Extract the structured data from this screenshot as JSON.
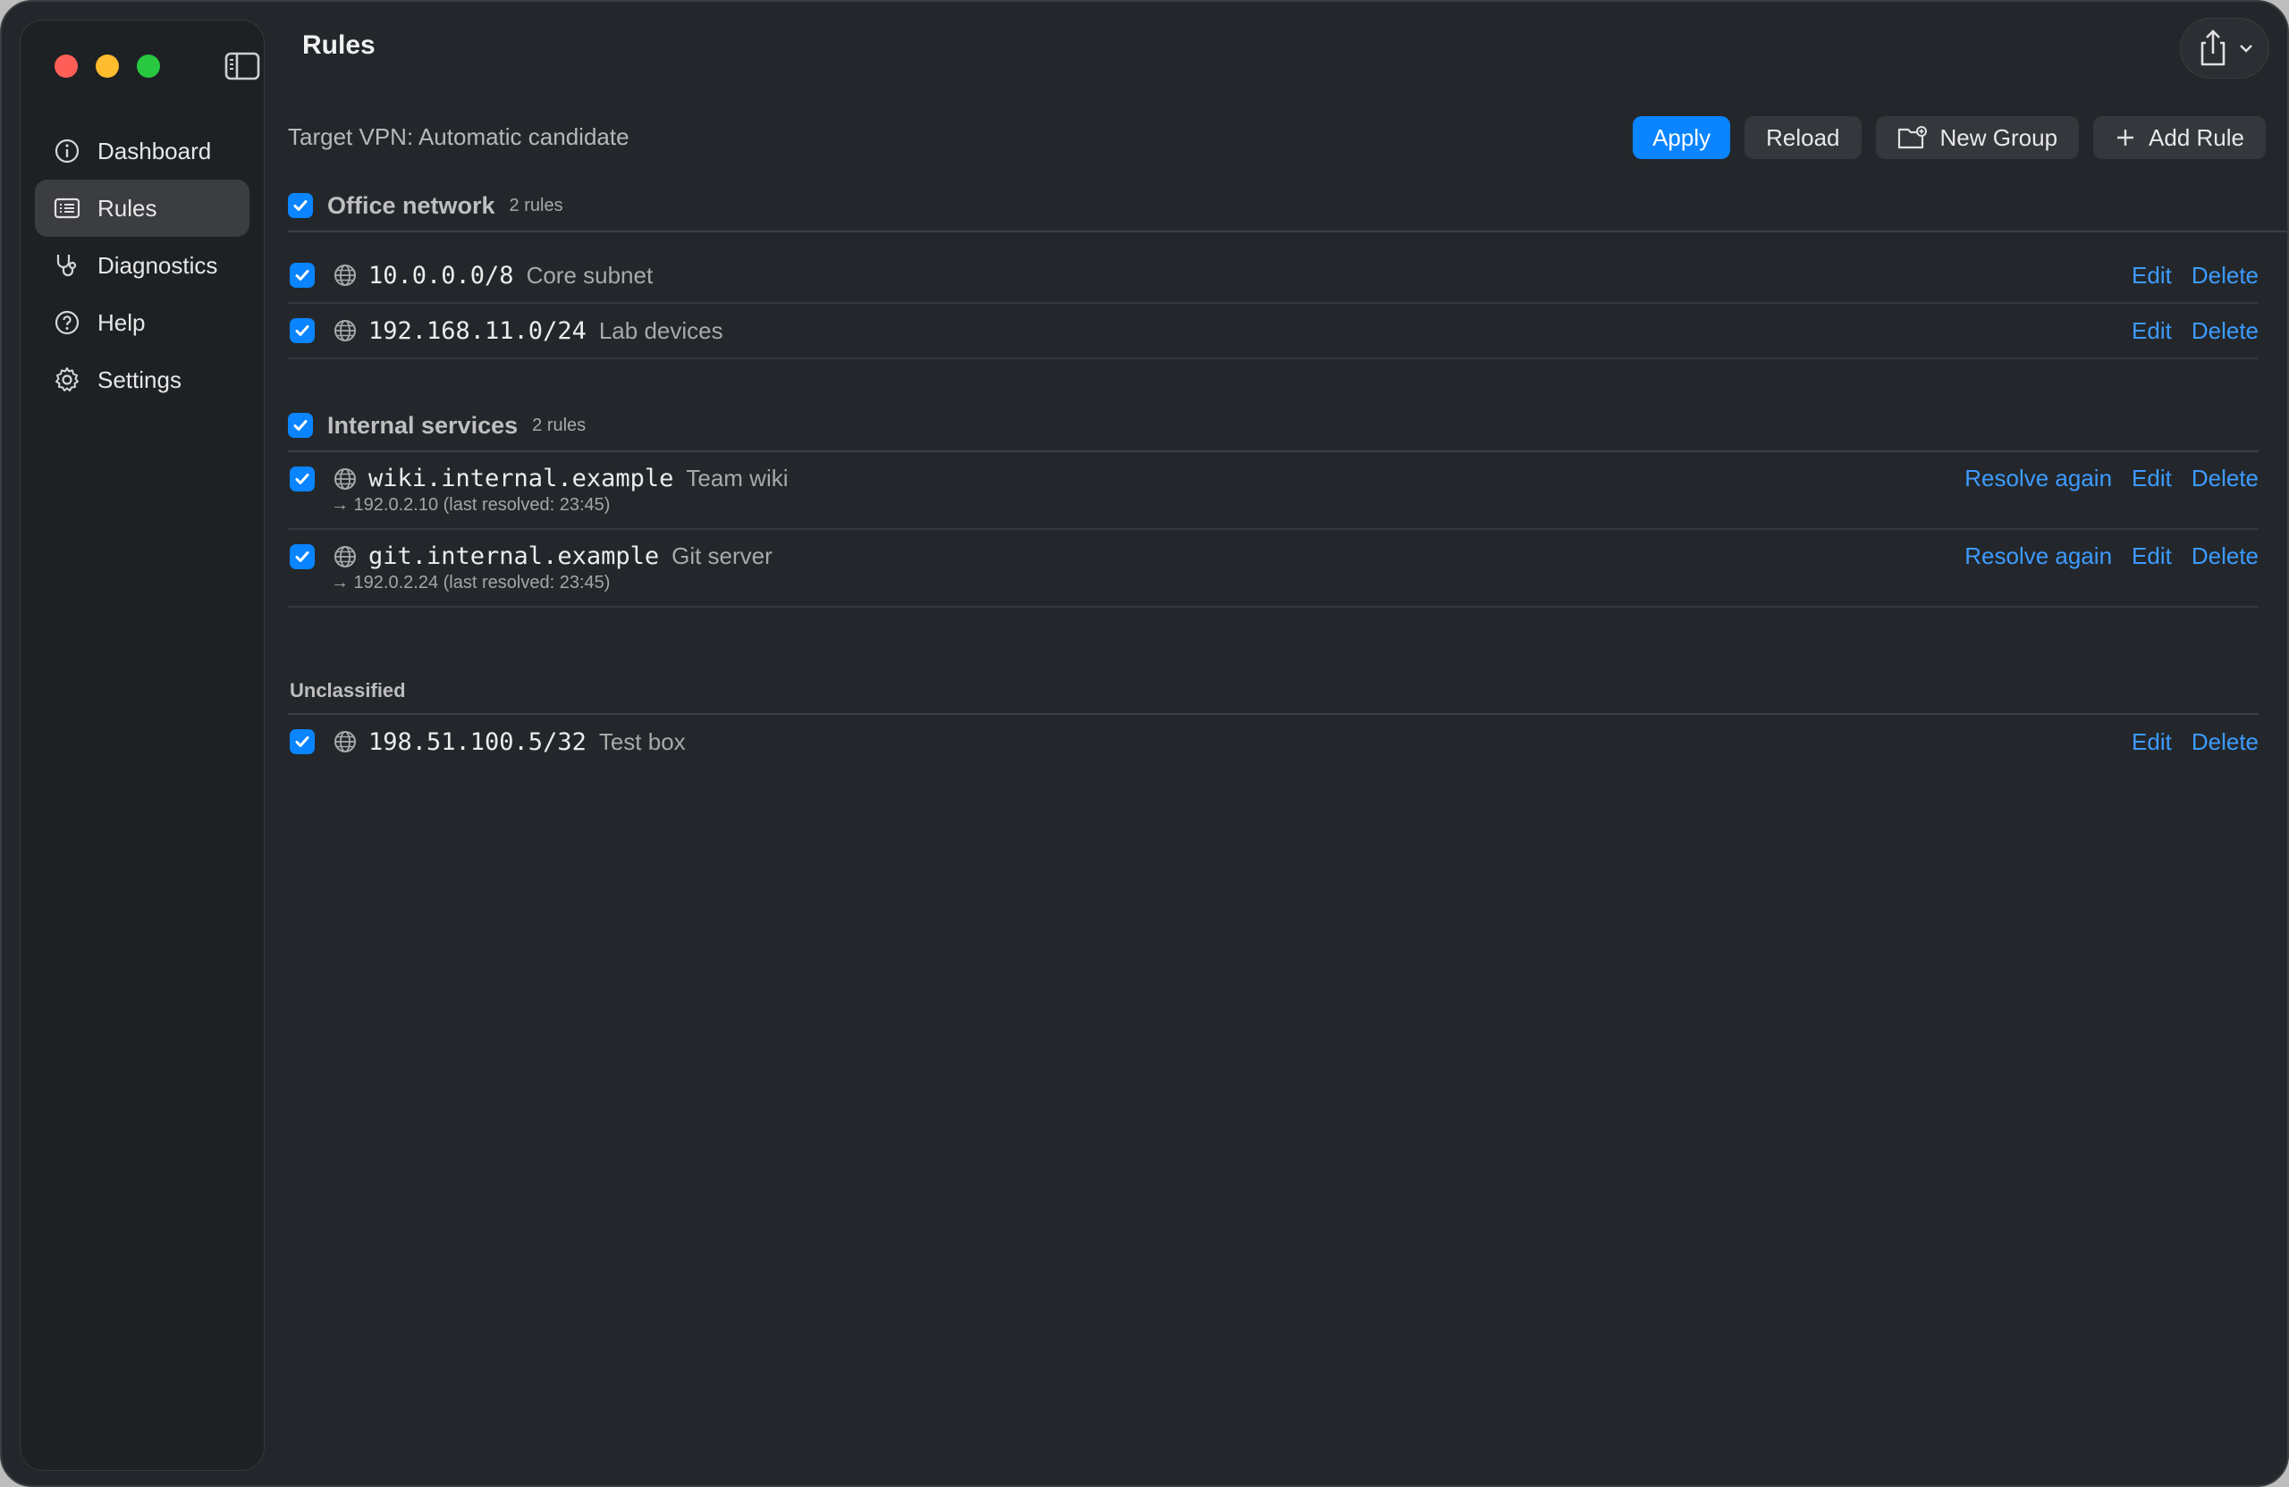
{
  "window": {
    "title": "Rules"
  },
  "sidebar": {
    "items": [
      {
        "label": "Dashboard",
        "icon": "info-circle-icon",
        "active": false
      },
      {
        "label": "Rules",
        "icon": "list-icon",
        "active": true
      },
      {
        "label": "Diagnostics",
        "icon": "stethoscope-icon",
        "active": false
      },
      {
        "label": "Help",
        "icon": "question-circle-icon",
        "active": false
      },
      {
        "label": "Settings",
        "icon": "gear-icon",
        "active": false
      }
    ]
  },
  "header": {
    "target_label": "Target VPN: Automatic candidate",
    "apply_label": "Apply",
    "reload_label": "Reload",
    "new_group_label": "New Group",
    "add_rule_label": "Add Rule"
  },
  "groups": [
    {
      "name": "Office network",
      "count": "2 rules",
      "rules": [
        {
          "address": "10.0.0.0/8",
          "description": "Core subnet"
        },
        {
          "address": "192.168.11.0/24",
          "description": "Lab devices"
        }
      ]
    },
    {
      "name": "Internal services",
      "count": "2 rules",
      "rules": [
        {
          "address": "wiki.internal.example",
          "description": "Team wiki",
          "resolved": "→ 192.0.2.10 (last resolved: 23:45)"
        },
        {
          "address": "git.internal.example",
          "description": "Git server",
          "resolved": "→ 192.0.2.24 (last resolved: 23:45)"
        }
      ]
    }
  ],
  "unclassified": {
    "label": "Unclassified",
    "rules": [
      {
        "address": "198.51.100.5/32",
        "description": "Test box"
      }
    ]
  },
  "actions": {
    "resolve_again": "Resolve again",
    "edit": "Edit",
    "delete": "Delete"
  },
  "colors": {
    "accent": "#0a84ff",
    "link": "#3d9bff",
    "background": "#23272b",
    "sidebar": "#1e2124"
  }
}
